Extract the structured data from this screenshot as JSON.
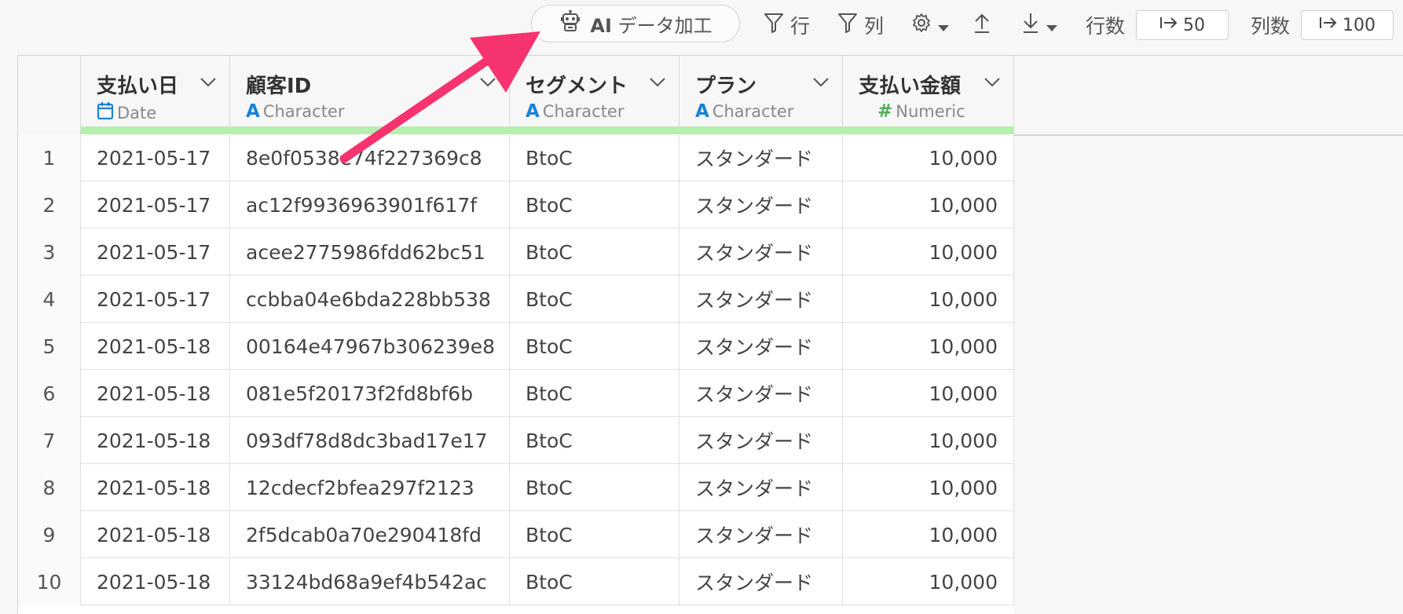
{
  "toolbar": {
    "ai_strong": "AI",
    "ai_label": "データ加工",
    "row_filter": "行",
    "col_filter": "列",
    "row_count_label": "行数",
    "row_count_value": "50",
    "col_count_label": "列数",
    "col_count_value": "100",
    "icons": {
      "ai": "robot-icon",
      "filter": "funnel-icon",
      "settings": "gear-icon",
      "sort_asc": "arrow-up-icon",
      "sort_desc": "arrow-down-icon",
      "goto": "arrow-right-bar-icon"
    }
  },
  "grid": {
    "columns": [
      {
        "name": "支払い日",
        "type": "Date",
        "type_icon": "calendar-icon"
      },
      {
        "name": "顧客ID",
        "type": "Character",
        "type_icon": "A"
      },
      {
        "name": "セグメント",
        "type": "Character",
        "type_icon": "A"
      },
      {
        "name": "プラン",
        "type": "Character",
        "type_icon": "A"
      },
      {
        "name": "支払い金額",
        "type": "Numeric",
        "type_icon": "#"
      }
    ],
    "rows": [
      {
        "n": "1",
        "date": "2021-05-17",
        "id": "8e0f0538e74f227369c8",
        "seg": "BtoC",
        "plan": "スタンダード",
        "amount": "10,000"
      },
      {
        "n": "2",
        "date": "2021-05-17",
        "id": "ac12f9936963901f617f",
        "seg": "BtoC",
        "plan": "スタンダード",
        "amount": "10,000"
      },
      {
        "n": "3",
        "date": "2021-05-17",
        "id": "acee2775986fdd62bc51",
        "seg": "BtoC",
        "plan": "スタンダード",
        "amount": "10,000"
      },
      {
        "n": "4",
        "date": "2021-05-17",
        "id": "ccbba04e6bda228bb538",
        "seg": "BtoC",
        "plan": "スタンダード",
        "amount": "10,000"
      },
      {
        "n": "5",
        "date": "2021-05-18",
        "id": "00164e47967b306239e8",
        "seg": "BtoC",
        "plan": "スタンダード",
        "amount": "10,000"
      },
      {
        "n": "6",
        "date": "2021-05-18",
        "id": "081e5f20173f2fd8bf6b",
        "seg": "BtoC",
        "plan": "スタンダード",
        "amount": "10,000"
      },
      {
        "n": "7",
        "date": "2021-05-18",
        "id": "093df78d8dc3bad17e17",
        "seg": "BtoC",
        "plan": "スタンダード",
        "amount": "10,000"
      },
      {
        "n": "8",
        "date": "2021-05-18",
        "id": "12cdecf2bfea297f2123",
        "seg": "BtoC",
        "plan": "スタンダード",
        "amount": "10,000"
      },
      {
        "n": "9",
        "date": "2021-05-18",
        "id": "2f5dcab0a70e290418fd",
        "seg": "BtoC",
        "plan": "スタンダード",
        "amount": "10,000"
      },
      {
        "n": "10",
        "date": "2021-05-18",
        "id": "33124bd68a9ef4b542ac",
        "seg": "BtoC",
        "plan": "スタンダード",
        "amount": "10,000"
      }
    ]
  },
  "colors": {
    "annotation_arrow": "#f5336f",
    "header_quality_bar": "#b6efb0",
    "type_character": "#1b82d6",
    "type_numeric": "#4cae5a"
  }
}
